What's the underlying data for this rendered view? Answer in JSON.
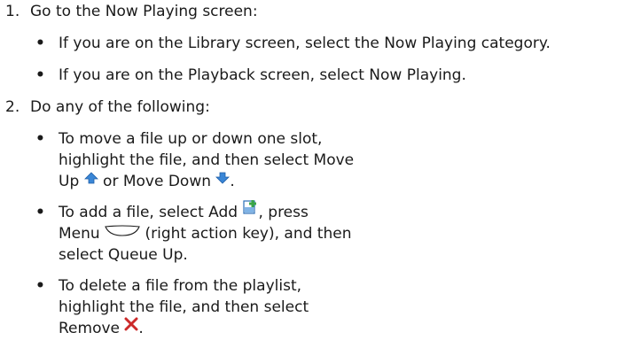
{
  "steps": [
    {
      "number": "1.",
      "text": "Go to the Now Playing screen:",
      "bullets": [
        {
          "text": "If you are on the Library screen, select the Now Playing category."
        },
        {
          "text": "If you are on the Playback screen, select Now Playing."
        }
      ]
    },
    {
      "number": "2.",
      "text": "Do any of the following:",
      "bullets": [
        {
          "line1": "To move a file up or down one slot,",
          "line2": "highlight the file, and then select Move",
          "line3a": "Up",
          "line3b": "or Move Down",
          "line3c": ".",
          "icon_up": "move-up-arrow-icon",
          "icon_down": "move-down-arrow-icon"
        },
        {
          "line1a": "To add a file, select Add",
          "line1b": ", press",
          "line2a": "Menu",
          "line2b": "(right action key), and then",
          "line3": "select Queue Up.",
          "icon_add": "add-file-icon",
          "icon_menu": "right-action-key-icon"
        },
        {
          "line1": "To delete a file from the playlist,",
          "line2": "highlight the file, and then select",
          "line3a": "Remove",
          "line3b": ".",
          "icon_remove": "remove-x-icon"
        }
      ]
    }
  ],
  "colors": {
    "text": "#1a1a1a",
    "arrow_blue": "#3a86d6",
    "add_green": "#3aa547",
    "remove_red": "#cc2a2a"
  }
}
